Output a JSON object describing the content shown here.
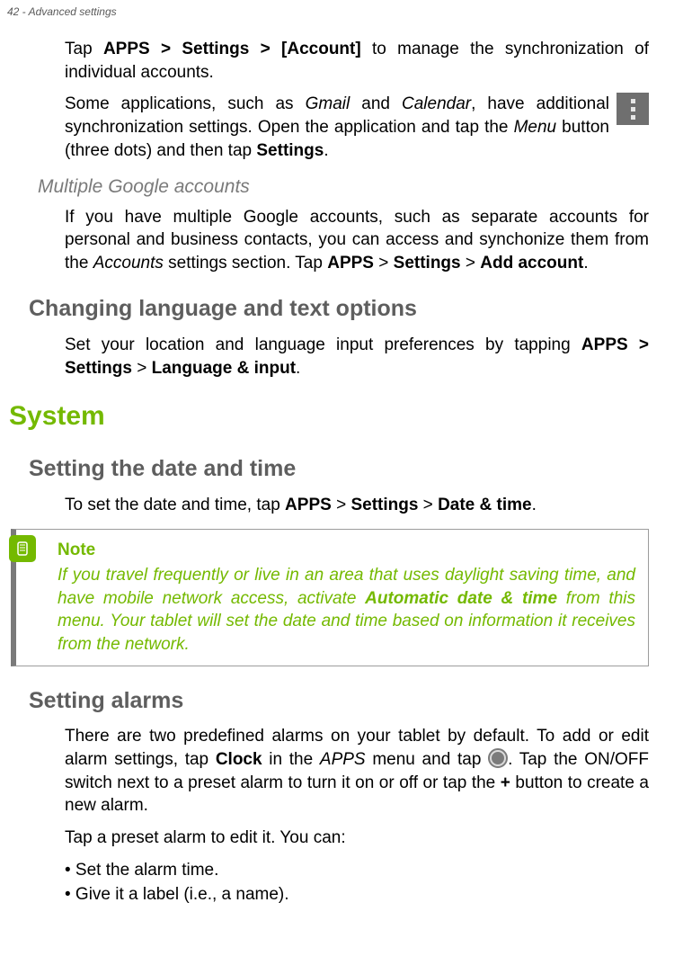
{
  "page_header": "42 - Advanced settings",
  "p1_a": "Tap ",
  "p1_b_path": "APPS > Settings > [Account]",
  "p1_c": " to manage the synchronization of individual accounts.",
  "p2_a": "Some applications, such as ",
  "p2_i1": "Gmail",
  "p2_b": " and ",
  "p2_i2": "Calendar",
  "p2_c": ", have additional synchronization settings. Open the application and tap the ",
  "p2_i3": "Menu",
  "p2_d": " button (three dots) and then tap ",
  "p2_b1": "Settings",
  "p2_e": ".",
  "h3_multi": "Multiple Google accounts",
  "p3_a": "If you have multiple Google accounts, such as separate accounts for personal and business contacts, you can access and synchonize them from the ",
  "p3_i1": "Accounts",
  "p3_b": " settings section. Tap ",
  "p3_b1": "APPS",
  "p3_gt1": " > ",
  "p3_b2": "Settings",
  "p3_gt2": " > ",
  "p3_b3": "Add account",
  "p3_c": ".",
  "h2_lang": "Changing language and text options",
  "p4_a": "Set your location and language input preferences by tapping ",
  "p4_b1": "APPS > Settings",
  "p4_b": " > ",
  "p4_b2": "Language & input",
  "p4_c": ".",
  "h1_system": "System",
  "h2_date": "Setting the date and time",
  "p5_a": "To set the date and time, tap ",
  "p5_b1": "APPS",
  "p5_gt1": " > ",
  "p5_b2": "Settings",
  "p5_gt2": " > ",
  "p5_b3": "Date & time",
  "p5_c": ".",
  "note_title": "Note",
  "note_a": "If you travel frequently or live in an area that uses daylight saving time, and have mobile network access, activate ",
  "note_b": "Automatic date & time",
  "note_c": " from this menu. Your tablet will set the date and time based on information it receives from the network.",
  "h2_alarms": "Setting alarms",
  "p6_a": "There are two predefined alarms on your tablet by default. To add or edit alarm settings, tap ",
  "p6_b1": "Clock",
  "p6_b": " in the ",
  "p6_i1": "APPS",
  "p6_c": " menu and tap ",
  "p6_d": ". Tap the ON/OFF switch next to a preset alarm to turn it on or off or tap the ",
  "p6_b2": "+",
  "p6_e": " button to create a new alarm.",
  "p7": "Tap a preset alarm to edit it. You can:",
  "bullet1": "•  Set the alarm time.",
  "bullet2": "•  Give it a label (i.e., a name)."
}
